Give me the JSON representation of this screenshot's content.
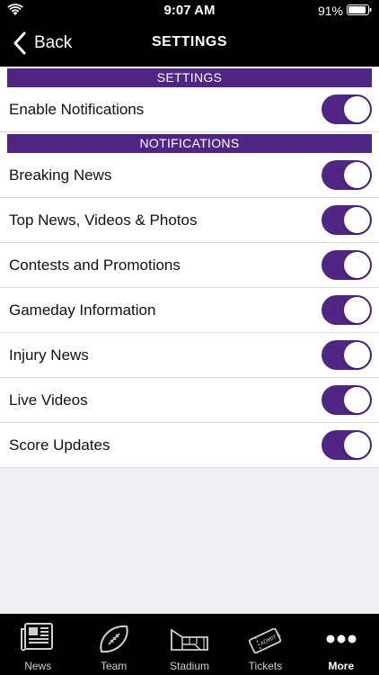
{
  "status_bar": {
    "time": "9:07 AM",
    "battery_percent": "91%",
    "battery_level": 0.91
  },
  "nav": {
    "back_label": "Back",
    "title": "SETTINGS"
  },
  "sections": [
    {
      "header": "SETTINGS",
      "rows": [
        {
          "label": "Enable Notifications",
          "on": true
        }
      ]
    },
    {
      "header": "NOTIFICATIONS",
      "rows": [
        {
          "label": "Breaking News",
          "on": true
        },
        {
          "label": "Top News, Videos & Photos",
          "on": true
        },
        {
          "label": "Contests and Promotions",
          "on": true
        },
        {
          "label": "Gameday Information",
          "on": true
        },
        {
          "label": "Injury News",
          "on": true
        },
        {
          "label": "Live Videos",
          "on": true
        },
        {
          "label": "Score Updates",
          "on": true
        }
      ]
    }
  ],
  "tab_bar": {
    "items": [
      {
        "label": "News",
        "icon": "newspaper-icon",
        "active": false
      },
      {
        "label": "Team",
        "icon": "football-icon",
        "active": false
      },
      {
        "label": "Stadium",
        "icon": "stadium-icon",
        "active": false
      },
      {
        "label": "Tickets",
        "icon": "ticket-icon",
        "active": false
      },
      {
        "label": "More",
        "icon": "more-dots-icon",
        "active": true
      }
    ]
  },
  "colors": {
    "accent": "#4f2683",
    "bar_background": "#000000",
    "page_background": "#efeff4"
  }
}
